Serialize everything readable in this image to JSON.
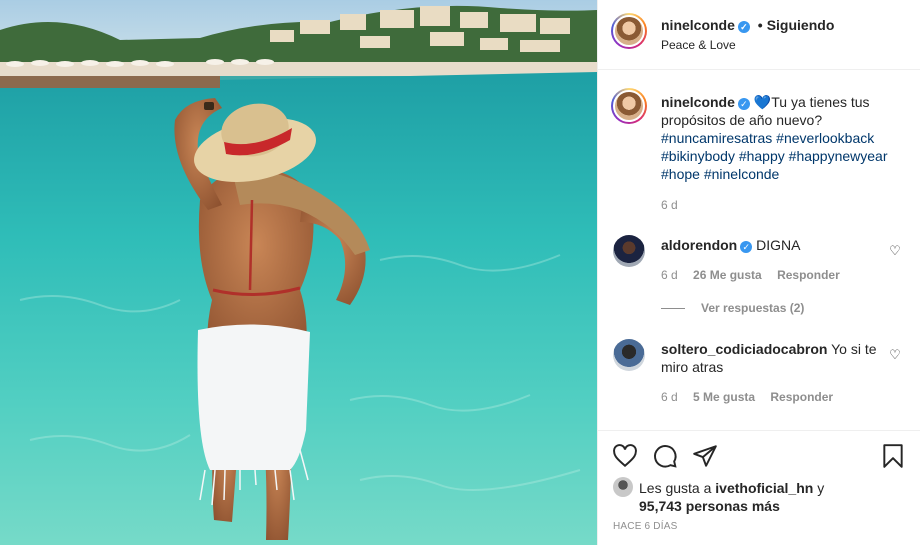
{
  "post": {
    "image_alt": "Woman in hat at the beach"
  },
  "header": {
    "username": "ninelconde",
    "separator": "•",
    "follow_status": "Siguiendo",
    "subtitle": "Peace & Love"
  },
  "caption": {
    "username": "ninelconde",
    "emoji": "💙",
    "text": "Tu ya tienes tus propósitos de año nuevo?",
    "hashtags": [
      "#nuncamiresatras",
      "#neverlookback",
      "#bikinybody",
      "#happy",
      "#happynewyear",
      "#hope",
      "#ninelconde"
    ],
    "time": "6 d"
  },
  "comments": [
    {
      "username": "aldorendon",
      "verified": true,
      "text": "DIGNA",
      "time": "6 d",
      "likes": "26 Me gusta",
      "reply_label": "Responder",
      "view_replies": "Ver respuestas (2)"
    },
    {
      "username": "soltero_codiciadocabron",
      "verified": false,
      "text": "Yo si te miro atras",
      "time": "6 d",
      "likes": "5 Me gusta",
      "reply_label": "Responder"
    }
  ],
  "actions": {
    "like_icon": "heart-icon",
    "comment_icon": "comment-icon",
    "share_icon": "paper-plane-icon",
    "save_icon": "bookmark-icon"
  },
  "likes": {
    "prefix": "Les gusta a",
    "user": "ivethoficial_hn",
    "conj": "y",
    "count": "95,743 personas más"
  },
  "post_date": "HACE 6 DÍAS",
  "colors": {
    "verified": "#3897f0",
    "hashtag": "#00376b",
    "muted": "#8e8e8e"
  }
}
